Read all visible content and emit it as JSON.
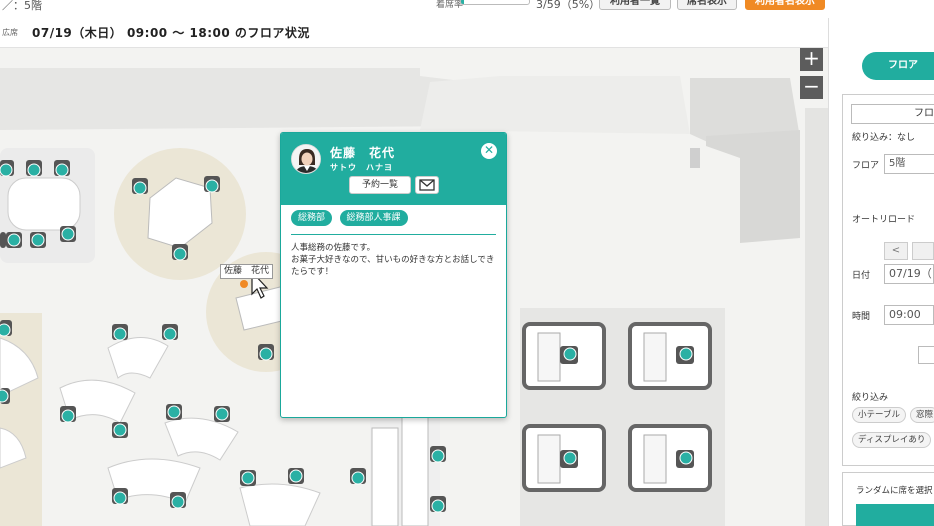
{
  "header": {
    "breadcrumb": "／：5階",
    "occupancy_label": "着席率",
    "occupancy_fraction": 0.05,
    "occupancy_count": "3/59（5%）",
    "btn_user_list": "利用者一覧",
    "btn_seat_view": "席名表示",
    "btn_user_view": "利用者名表示",
    "cut_label": "広席",
    "floor_status_title": "07/19（木日） 09:00 ～ 18:00 のフロア状況"
  },
  "map": {
    "zoom_in": "+",
    "zoom_out": "−",
    "hover_tooltip": "佐藤　花代",
    "colors": {
      "seat_dot": "#2ab0a4",
      "table": "#ffffff",
      "zone": "#ebe6d6",
      "wall": "#cfcfcf"
    }
  },
  "popup": {
    "name": "佐藤　花代",
    "kana": "サトウ　ハナヨ",
    "reserve_button": "予約一覧",
    "mail_icon": "mail-icon",
    "close_icon": "close-icon",
    "tags": [
      "総務部",
      "総務部人事課"
    ],
    "bio": "人事総務の佐藤です。\nお菓子大好きなので、甘いもの好きな方とお話しできたらです！",
    "accent_color": "#21ad9f"
  },
  "panel": {
    "tab_floor": "フロア",
    "floor_select_label": "フロ",
    "filter_label": "絞り込み：なし",
    "floor_label": "フロア",
    "floor_value": "5階",
    "auto_reload_label": "オートリロード",
    "prev_button": "<",
    "date_label": "日付",
    "date_value": "07/19（",
    "time_label": "時間",
    "time_value": "09:00",
    "filter_section_label": "絞り込み",
    "chips": [
      "小テーブル",
      "窓際",
      "ディスプレイあり"
    ],
    "random_label": "ランダムに席を選択"
  }
}
